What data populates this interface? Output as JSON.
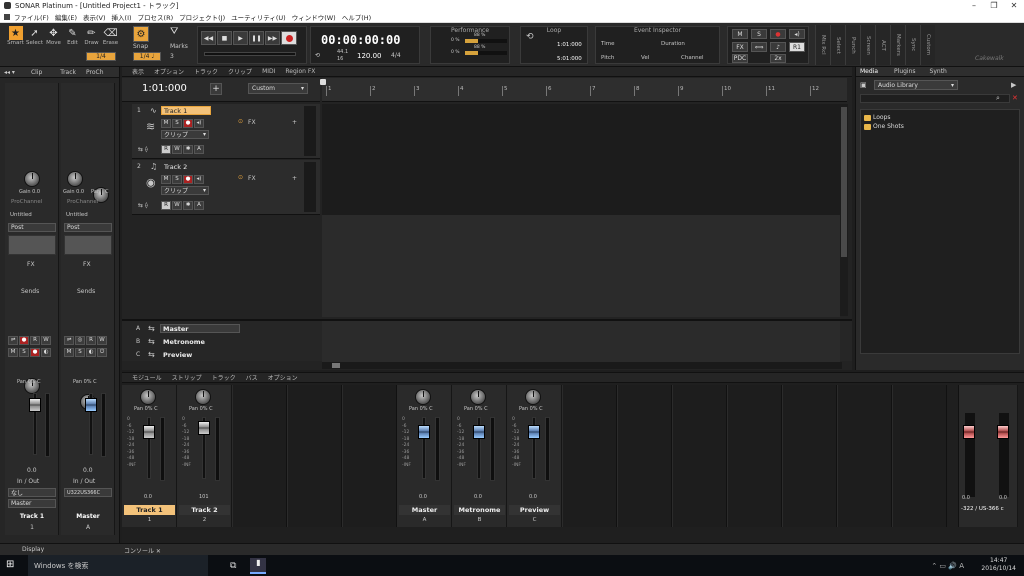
{
  "window": {
    "title": "SONAR Platinum - [Untitled Project1 - トラック]",
    "min": "–",
    "max": "❐",
    "close": "✕"
  },
  "menu": [
    "ファイル(F)",
    "編集(E)",
    "表示(V)",
    "挿入(I)",
    "プロセス(R)",
    "プロジェクト(J)",
    "ユーティリティ(U)",
    "ウィンドウ(W)",
    "ヘルプ(H)"
  ],
  "tools": [
    {
      "label": "Smart",
      "icon": "★"
    },
    {
      "label": "Select",
      "icon": "➚"
    },
    {
      "label": "Move",
      "icon": "✥"
    },
    {
      "label": "Edit",
      "icon": "✎"
    },
    {
      "label": "Draw",
      "icon": "✏"
    },
    {
      "label": "Erase",
      "icon": "⌫"
    }
  ],
  "tools_snap": "1/4",
  "snap": {
    "label": "Snap",
    "value": "1/4 ♩",
    "marks": "Marks",
    "marks_num": "3"
  },
  "transport": {
    "time": "00:00:00:00",
    "tempo": "120.00",
    "sig": "4/4",
    "khz": "44.1",
    "bits": "16"
  },
  "performance": {
    "title": "Performance",
    "cpu": "0 %",
    "disk": "0 %",
    "l1": "88 %",
    "l2": "88 %"
  },
  "loop": {
    "title": "Loop",
    "start": "1:01:000",
    "end": "5:01:000"
  },
  "inspector": {
    "title": "Event Inspector",
    "time": "Time",
    "duration": "Duration",
    "pitch": "Pitch",
    "vel": "Vel",
    "channel": "Channel"
  },
  "mixbtns": {
    "m": "M",
    "s": "S",
    "fx": "FX",
    "pdc": "PDC",
    "x2": "2x",
    "r1": "R1"
  },
  "side_tabs": [
    "Mix Rcl",
    "Select",
    "Punch",
    "Screen",
    "ACT",
    "Markers",
    "Sync",
    "Custom"
  ],
  "brand": "Cakewalk",
  "inspector_panel": {
    "tabs": [
      "Clip",
      "Track",
      "ProCh"
    ],
    "strips": [
      {
        "gain": "Gain 0.0",
        "pan_label": "Pan",
        "pan_val": "C",
        "untitled": "Untitled",
        "post": "Post",
        "fx": "FX",
        "sends": "Sends",
        "pan2": "Pan 0% C",
        "vol": "0.0",
        "io": "In / Out",
        "in": "なし",
        "out": "Master",
        "name": "Track 1",
        "num": "1"
      },
      {
        "gain": "Gain 0.0",
        "pan_label": "Pan",
        "pan_val": "C",
        "untitled": "Untitled",
        "post": "Post",
        "fx": "FX",
        "sends": "Sends",
        "pan2": "Pan 0% C",
        "vol": "0.0",
        "io": "In / Out",
        "in": "U322US366C",
        "out": "Master",
        "name": "Master",
        "num": "A"
      }
    ]
  },
  "track_menu": [
    "表示",
    "オプション",
    "トラック",
    "クリップ",
    "MIDI",
    "Region FX"
  ],
  "now_time": "1:01:000",
  "custom": "Custom",
  "ruler": [
    "1",
    "2",
    "3",
    "4",
    "5",
    "6",
    "7",
    "8",
    "9",
    "10",
    "11",
    "12"
  ],
  "tracks": [
    {
      "num": "1",
      "name": "Track 1",
      "clip": "クリップ",
      "fx": "FX",
      "m": "M",
      "s": "S",
      "r": "R",
      "w": "W",
      "a": "A",
      "sel": true
    },
    {
      "num": "2",
      "name": "Track 2",
      "clip": "クリップ",
      "fx": "FX",
      "m": "M",
      "s": "S",
      "r": "R",
      "w": "W",
      "a": "A",
      "sel": false
    }
  ],
  "buses": [
    {
      "letter": "A",
      "name": "Master"
    },
    {
      "letter": "B",
      "name": "Metronome"
    },
    {
      "letter": "C",
      "name": "Preview"
    }
  ],
  "browser": {
    "tabs": [
      "Media",
      "Plugins",
      "Synth"
    ],
    "library": "Audio Library",
    "folders": [
      "Loops",
      "One Shots"
    ]
  },
  "console_menu": [
    "モジュール",
    "ストリップ",
    "トラック",
    "バス",
    "オプション"
  ],
  "console": [
    {
      "pan": "Pan 0% C",
      "vol": "0.0",
      "name": "Track 1",
      "num": "1",
      "sel": true
    },
    {
      "pan": "Pan 0% C",
      "vol": "101",
      "name": "Track 2",
      "num": "2",
      "sel": false
    },
    {
      "pan": "Pan 0% C",
      "vol": "0.0",
      "name": "Master",
      "num": "A",
      "sel": false
    },
    {
      "pan": "Pan 0% C",
      "vol": "0.0",
      "name": "Metronome",
      "num": "B",
      "sel": false
    },
    {
      "pan": "Pan 0% C",
      "vol": "0.0",
      "name": "Preview",
      "num": "C",
      "sel": false
    }
  ],
  "hw_out": {
    "vol_l": "0.0",
    "vol_r": "0.0",
    "name": "-322 / US-366 c"
  },
  "bottom_tabs": {
    "display": "Display",
    "console": "コンソール ✕"
  },
  "taskbar": {
    "search": "Windows を検索",
    "time": "14:47",
    "date": "2016/10/14"
  },
  "colors": {
    "accent": "#e8a43c",
    "selected_track": "#f3c27a"
  }
}
